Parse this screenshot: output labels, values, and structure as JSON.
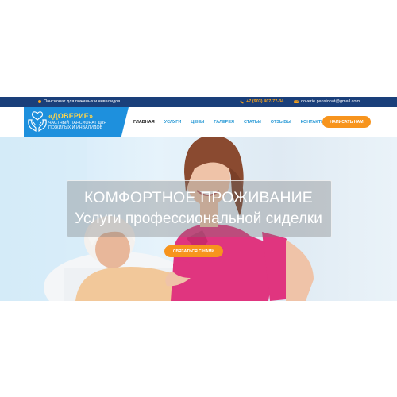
{
  "topbar": {
    "tagline": "Пансионат для пожилых и инвалидов",
    "phone": "+7 (903) 407-77-34",
    "email": "doverie.pansionat@gmail.com"
  },
  "brand": {
    "name": "«ДОВЕРИЕ»",
    "subtitle_line1": "ЧАСТНЫЙ ПАНСИОНАТ ДЛЯ",
    "subtitle_line2": "ПОЖИЛЫХ И ИНВАЛИДОВ"
  },
  "nav": {
    "items": [
      {
        "label": "ГЛАВНАЯ",
        "active": true
      },
      {
        "label": "УСЛУГИ",
        "active": false
      },
      {
        "label": "ЦЕНЫ",
        "active": false
      },
      {
        "label": "ГАЛЕРЕЯ",
        "active": false
      },
      {
        "label": "СТАТЬИ",
        "active": false
      },
      {
        "label": "ОТЗЫВЫ",
        "active": false
      },
      {
        "label": "КОНТАКТЫ",
        "active": false
      }
    ],
    "cta_label": "НАПИСАТЬ НАМ"
  },
  "hero": {
    "title": "КОМФОРТНОЕ ПРОЖИВАНИЕ",
    "subtitle": "Услуги профессиональной сиделки",
    "button_label": "СВЯЗАТЬСЯ С НАМИ"
  },
  "colors": {
    "topbar_bg": "#1a3f7a",
    "brand_blue": "#1e90dd",
    "accent_orange": "#f7941d",
    "nav_link": "#2a9ad6",
    "caregiver_uniform": "#e0357f"
  },
  "icons": [
    "dot-icon",
    "phone-icon",
    "mail-icon",
    "hands-heart-logo-icon"
  ]
}
